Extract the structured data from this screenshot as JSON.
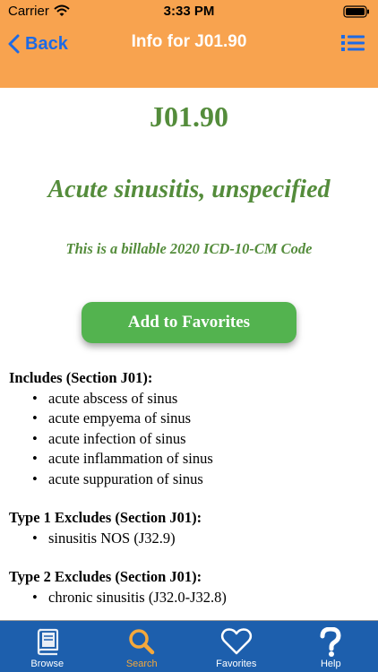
{
  "status": {
    "carrier": "Carrier",
    "time": "3:33 PM"
  },
  "nav": {
    "back_label": "Back",
    "title": "Info for J01.90"
  },
  "code": {
    "id": "J01.90",
    "description": "Acute sinusitis, unspecified",
    "billable_note": "This is a billable 2020 ICD-10-CM Code"
  },
  "favorites_button": "Add to Favorites",
  "sections": [
    {
      "title": "Includes (Section J01):",
      "items": [
        "acute abscess of sinus",
        "acute empyema of sinus",
        "acute infection of sinus",
        "acute inflammation of sinus",
        "acute suppuration of sinus"
      ]
    },
    {
      "title": "Type 1 Excludes (Section J01):",
      "items": [
        "sinusitis NOS (J32.9)"
      ]
    },
    {
      "title": "Type 2 Excludes (Section J01):",
      "items": [
        "chronic sinusitis (J32.0-J32.8)"
      ]
    }
  ],
  "tabs": [
    {
      "label": "Browse",
      "icon": "book-icon"
    },
    {
      "label": "Search",
      "icon": "search-icon",
      "active": true
    },
    {
      "label": "Favorites",
      "icon": "heart-icon"
    },
    {
      "label": "Help",
      "icon": "question-icon"
    }
  ],
  "colors": {
    "header": "#f8a34f",
    "accent_blue": "#1d6ae5",
    "code_green": "#548c3b",
    "button_green": "#53b34f",
    "tab_bar": "#1d5fad",
    "tab_active": "#f4a83c"
  }
}
